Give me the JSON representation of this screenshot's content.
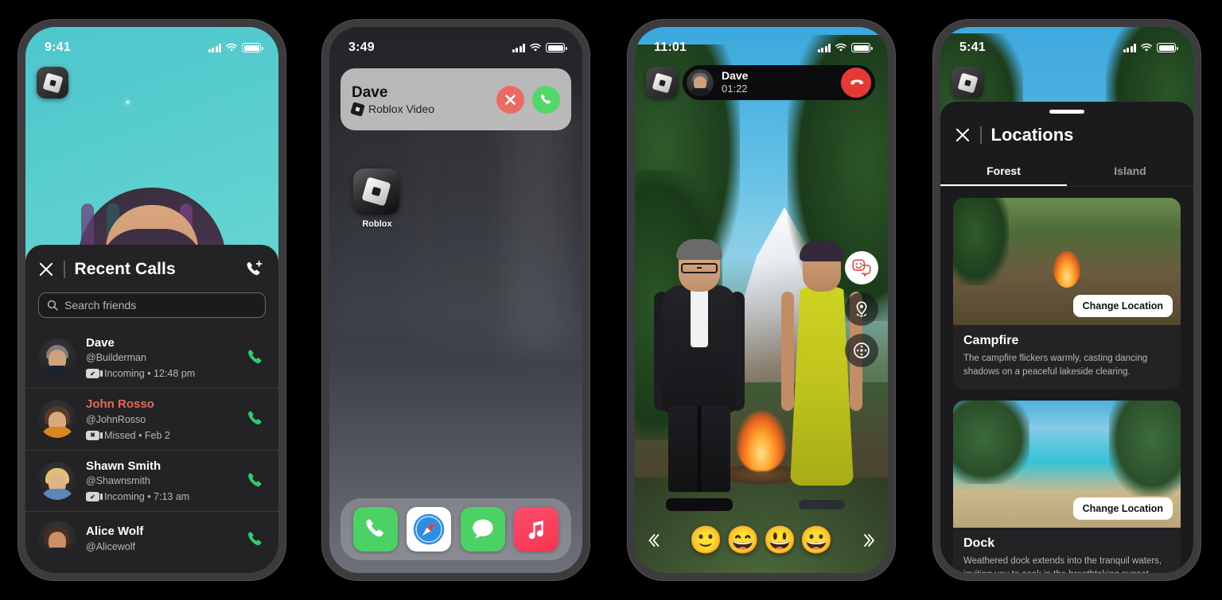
{
  "phone1": {
    "status": {
      "time": "9:41"
    },
    "app_badge": "roblox-logo",
    "sheet": {
      "title": "Recent Calls",
      "close_label": "×",
      "new_call_label": "new-call",
      "search": {
        "placeholder": "Search friends",
        "value": ""
      },
      "calls": [
        {
          "name": "Dave",
          "handle": "@Builderman",
          "status": "Incoming • 12:48 pm",
          "type": "incoming",
          "missed": false
        },
        {
          "name": "John Rosso",
          "handle": "@JohnRosso",
          "status": "Missed • Feb 2",
          "type": "missed",
          "missed": true
        },
        {
          "name": "Shawn Smith",
          "handle": "@Shawnsmith",
          "status": "Incoming • 7:13 am",
          "type": "incoming",
          "missed": false
        },
        {
          "name": "Alice Wolf",
          "handle": "@Alicewolf",
          "status": "",
          "type": "incoming",
          "missed": false
        }
      ]
    }
  },
  "phone2": {
    "status": {
      "time": "3:49"
    },
    "notification": {
      "name": "Dave",
      "subtitle": "Roblox Video",
      "decline_label": "decline",
      "accept_label": "accept"
    },
    "home_app": {
      "label": "Roblox"
    },
    "dock": [
      {
        "name": "Phone"
      },
      {
        "name": "Safari"
      },
      {
        "name": "Messages"
      },
      {
        "name": "Music"
      }
    ]
  },
  "phone3": {
    "status": {
      "time": "11:01"
    },
    "call": {
      "name": "Dave",
      "timer": "01:22",
      "end_label": "end-call"
    },
    "side_buttons": [
      {
        "name": "stickers"
      },
      {
        "name": "location"
      },
      {
        "name": "camera-controls"
      }
    ],
    "emoji_bar": {
      "prev": "‹‹",
      "next": "››",
      "emojis": [
        "🙂",
        "😄",
        "😃",
        "😀"
      ]
    }
  },
  "phone4": {
    "status": {
      "time": "5:41"
    },
    "sheet": {
      "title": "Locations",
      "close_label": "×",
      "tabs": [
        {
          "label": "Forest",
          "active": true
        },
        {
          "label": "Island",
          "active": false
        }
      ],
      "cards": [
        {
          "name": "Campfire",
          "description": "The campfire flickers warmly, casting dancing shadows on a peaceful lakeside clearing.",
          "button": "Change Location",
          "scene": "forest"
        },
        {
          "name": "Dock",
          "description": "Weathered dock extends into the tranquil waters, inviting you to soak in the breathtaking sunset.",
          "button": "Change Location",
          "scene": "island"
        }
      ]
    }
  },
  "colors": {
    "accent_green": "#2ecc6f",
    "missed_red": "#e4685d",
    "decline_red": "#ec6a62",
    "accept_green": "#52d869",
    "end_red": "#e53935",
    "sheet_bg": "#232325",
    "phone_bezel": "#3c3c3e"
  }
}
